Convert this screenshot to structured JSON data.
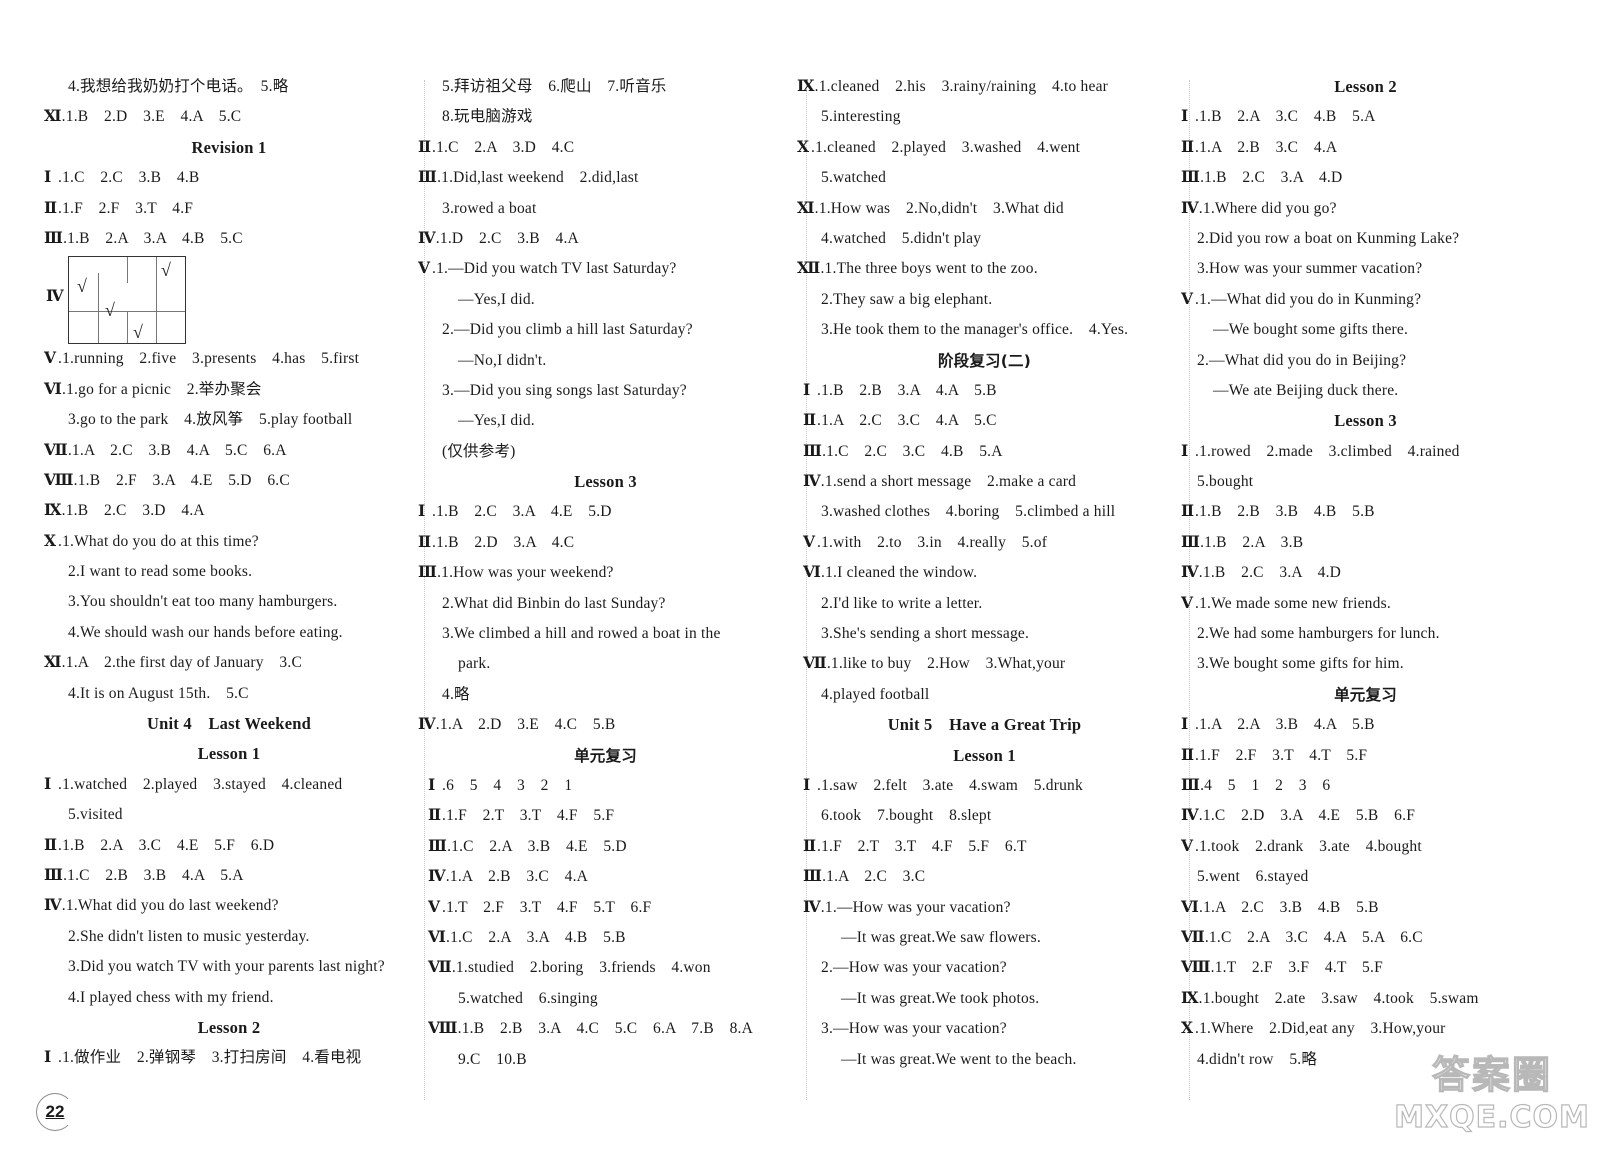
{
  "page_number": "22",
  "watermark": {
    "cn": "答案圈",
    "en": "MXQE.COM"
  },
  "col1": {
    "l01": "4.我想给我奶奶打个电话。　5.略",
    "l02": {
      "roman": "Ⅺ",
      "text": ".1.B　2.D　3.E　4.A　5.C"
    },
    "h_revision1": "Revision 1",
    "l03": {
      "roman": "Ⅰ",
      "text": ".1.C　2.C　3.B　4.B"
    },
    "l04": {
      "roman": "Ⅱ",
      "text": ".1.F　2.F　3.T　4.F"
    },
    "l05": {
      "roman": "Ⅲ",
      "text": ".1.B　2.A　3.A　4.B　5.C"
    },
    "grid": {
      "roman": "Ⅳ",
      "tick": "√",
      "checked_cells": [
        "row1-col1",
        "row1-col2",
        "row1-col4",
        "row2-col3"
      ]
    },
    "l06": {
      "roman": "Ⅴ",
      "text": ".1.running　2.five　3.presents　4.has　5.first"
    },
    "l07": {
      "roman": "Ⅵ",
      "text": ".1.go for a picnic　2.举办聚会"
    },
    "l08": "3.go to the park　4.放风筝　5.play football",
    "l09": {
      "roman": "Ⅶ",
      "text": ".1.A　2.C　3.B　4.A　5.C　6.A"
    },
    "l10": {
      "roman": "Ⅷ",
      "text": ".1.B　2.F　3.A　4.E　5.D　6.C"
    },
    "l11": {
      "roman": "Ⅸ",
      "text": ".1.B　2.C　3.D　4.A"
    },
    "l12": {
      "roman": "Ⅹ",
      "text": ".1.What do you do at this time?"
    },
    "l13": "2.I want to read some books.",
    "l14": "3.You shouldn't eat too many hamburgers.",
    "l15": "4.We should wash our hands before eating.",
    "l16": {
      "roman": "Ⅺ",
      "text": ".1.A　2.the first day of January　3.C"
    },
    "l17": "4.It is on August 15th.　5.C",
    "h_unit4": "Unit 4　Last Weekend",
    "h_lesson1": "Lesson 1",
    "l18": {
      "roman": "Ⅰ",
      "text": ".1.watched　2.played　3.stayed　4.cleaned"
    },
    "l19": "5.visited",
    "l20": {
      "roman": "Ⅱ",
      "text": ".1.B　2.A　3.C　4.E　5.F　6.D"
    },
    "l21": {
      "roman": "Ⅲ",
      "text": ".1.C　2.B　3.B　4.A　5.A"
    },
    "l22": {
      "roman": "Ⅳ",
      "text": ".1.What did you do last weekend?"
    },
    "l23": "2.She didn't listen to music yesterday.",
    "l24": "3.Did you watch TV with your parents last night?",
    "l25": "4.I played chess with my friend.",
    "h_lesson2": "Lesson 2",
    "l26": {
      "roman": "Ⅰ",
      "text": ".1.做作业　2.弹钢琴　3.打扫房间　4.看电视"
    }
  },
  "col2": {
    "l01": "5.拜访祖父母　6.爬山　7.听音乐",
    "l02": "8.玩电脑游戏",
    "l03": {
      "roman": "Ⅱ",
      "text": ".1.C　2.A　3.D　4.C"
    },
    "l04": {
      "roman": "Ⅲ",
      "text": ".1.Did,last weekend　2.did,last"
    },
    "l05": "3.rowed a boat",
    "l06": {
      "roman": "Ⅳ",
      "text": ".1.D　2.C　3.B　4.A"
    },
    "l07": {
      "roman": "Ⅴ",
      "text": ".1.—Did you watch TV last Saturday?"
    },
    "l08": "—Yes,I did.",
    "l09": "2.—Did you climb a hill last Saturday?",
    "l10": "—No,I didn't.",
    "l11": "3.—Did you sing songs last Saturday?",
    "l12": "—Yes,I did.",
    "l13": "(仅供参考)",
    "h_lesson3": "Lesson 3",
    "l14": {
      "roman": "Ⅰ",
      "text": ".1.B　2.C　3.A　4.E　5.D"
    },
    "l15": {
      "roman": "Ⅱ",
      "text": ".1.B　2.D　3.A　4.C"
    },
    "l16": {
      "roman": "Ⅲ",
      "text": ".1.How was your weekend?"
    },
    "l17": "2.What did Binbin do last Sunday?",
    "l18": "3.We climbed a hill and rowed a boat in the",
    "l19": "park.",
    "l20": "4.略",
    "l21": {
      "roman": "Ⅳ",
      "text": ".1.A　2.D　3.E　4.C　5.B"
    },
    "h_review": "单元复习",
    "l22": {
      "roman": "Ⅰ",
      "text": ".6　5　4　3　2　1"
    },
    "l23": {
      "roman": "Ⅱ",
      "text": ".1.F　2.T　3.T　4.F　5.F"
    },
    "l24": {
      "roman": "Ⅲ",
      "text": ".1.C　2.A　3.B　4.E　5.D"
    },
    "l25": {
      "roman": "Ⅳ",
      "text": ".1.A　2.B　3.C　4.A"
    },
    "l26": {
      "roman": "Ⅴ",
      "text": ".1.T　2.F　3.T　4.F　5.T　6.F"
    },
    "l27": {
      "roman": "Ⅵ",
      "text": ".1.C　2.A　3.A　4.B　5.B"
    },
    "l28": {
      "roman": "Ⅶ",
      "text": ".1.studied　2.boring　3.friends　4.won"
    },
    "l29": "5.watched　6.singing",
    "l30": {
      "roman": "Ⅷ",
      "text": ".1.B　2.B　3.A　4.C　5.C　6.A　7.B　8.A"
    },
    "l31": "9.C　10.B"
  },
  "col3": {
    "l01": {
      "roman": "Ⅸ",
      "text": ".1.cleaned　2.his　3.rainy/raining　4.to hear"
    },
    "l02": "5.interesting",
    "l03": {
      "roman": "Ⅹ",
      "text": ".1.cleaned　2.played　3.washed　4.went"
    },
    "l04": "5.watched",
    "l05": {
      "roman": "Ⅺ",
      "text": ".1.How was　2.No,didn't　3.What did"
    },
    "l06": "4.watched　5.didn't play",
    "l07": {
      "roman": "Ⅻ",
      "text": ".1.The three boys went to the zoo."
    },
    "l08": "2.They saw a big elephant.",
    "l09": "3.He took them to the manager's office.　4.Yes.",
    "h_stage2": "阶段复习(二)",
    "l10": {
      "roman": "Ⅰ",
      "text": ".1.B　2.B　3.A　4.A　5.B"
    },
    "l11": {
      "roman": "Ⅱ",
      "text": ".1.A　2.C　3.C　4.A　5.C"
    },
    "l12": {
      "roman": "Ⅲ",
      "text": ".1.C　2.C　3.C　4.B　5.A"
    },
    "l13": {
      "roman": "Ⅳ",
      "text": ".1.send a short message　2.make a card"
    },
    "l14": "3.washed clothes　4.boring　5.climbed a hill",
    "l15": {
      "roman": "Ⅴ",
      "text": ".1.with　2.to　3.in　4.really　5.of"
    },
    "l16": {
      "roman": "Ⅵ",
      "text": ".1.I cleaned the window."
    },
    "l17": "2.I'd like to write a letter.",
    "l18": "3.She's sending a short message.",
    "l19": {
      "roman": "Ⅶ",
      "text": ".1.like to buy　2.How　3.What,your"
    },
    "l20": "4.played football",
    "h_unit5": "Unit 5　Have a Great Trip",
    "h_lesson1": "Lesson 1",
    "l21": {
      "roman": "Ⅰ",
      "text": ".1.saw　2.felt　3.ate　4.swam　5.drunk"
    },
    "l22": "6.took　7.bought　8.slept",
    "l23": {
      "roman": "Ⅱ",
      "text": ".1.F　2.T　3.T　4.F　5.F　6.T"
    },
    "l24": {
      "roman": "Ⅲ",
      "text": ".1.A　2.C　3.C"
    },
    "l25": {
      "roman": "Ⅳ",
      "text": ".1.—How was your vacation?"
    },
    "l26": "—It was great.We saw flowers.",
    "l27": "2.—How was your vacation?",
    "l28": "—It was great.We took photos.",
    "l29": "3.—How was your vacation?",
    "l30": "—It was great.We went to the beach."
  },
  "col4": {
    "h_lesson2": "Lesson 2",
    "l01": {
      "roman": "Ⅰ",
      "text": ".1.B　2.A　3.C　4.B　5.A"
    },
    "l02": {
      "roman": "Ⅱ",
      "text": ".1.A　2.B　3.C　4.A"
    },
    "l03": {
      "roman": "Ⅲ",
      "text": ".1.B　2.C　3.A　4.D"
    },
    "l04": {
      "roman": "Ⅳ",
      "text": ".1.Where did you go?"
    },
    "l05": "2.Did you row a boat on Kunming Lake?",
    "l06": "3.How was your summer vacation?",
    "l07": {
      "roman": "Ⅴ",
      "text": ".1.—What did you do in Kunming?"
    },
    "l08": "—We bought some gifts there.",
    "l09": "2.—What did you do in Beijing?",
    "l10": "—We ate Beijing duck there.",
    "h_lesson3": "Lesson 3",
    "l11": {
      "roman": "Ⅰ",
      "text": ".1.rowed　2.made　3.climbed　4.rained"
    },
    "l12": "5.bought",
    "l13": {
      "roman": "Ⅱ",
      "text": ".1.B　2.B　3.B　4.B　5.B"
    },
    "l14": {
      "roman": "Ⅲ",
      "text": ".1.B　2.A　3.B"
    },
    "l15": {
      "roman": "Ⅳ",
      "text": ".1.B　2.C　3.A　4.D"
    },
    "l16": {
      "roman": "Ⅴ",
      "text": ".1.We made some new friends."
    },
    "l17": "2.We had some hamburgers for lunch.",
    "l18": "3.We bought some gifts for him.",
    "h_review": "单元复习",
    "l19": {
      "roman": "Ⅰ",
      "text": ".1.A　2.A　3.B　4.A　5.B"
    },
    "l20": {
      "roman": "Ⅱ",
      "text": ".1.F　2.F　3.T　4.T　5.F"
    },
    "l21": {
      "roman": "Ⅲ",
      "text": ".4　5　1　2　3　6"
    },
    "l22": {
      "roman": "Ⅳ",
      "text": ".1.C　2.D　3.A　4.E　5.B　6.F"
    },
    "l23": {
      "roman": "Ⅴ",
      "text": ".1.took　2.drank　3.ate　4.bought"
    },
    "l24": "5.went　6.stayed",
    "l25": {
      "roman": "Ⅵ",
      "text": ".1.A　2.C　3.B　4.B　5.B"
    },
    "l26": {
      "roman": "Ⅶ",
      "text": ".1.C　2.A　3.C　4.A　5.A　6.C"
    },
    "l27": {
      "roman": "Ⅷ",
      "text": ".1.T　2.F　3.F　4.T　5.F"
    },
    "l28": {
      "roman": "Ⅸ",
      "text": ".1.bought　2.ate　3.saw　4.took　5.swam"
    },
    "l29": {
      "roman": "Ⅹ",
      "text": ".1.Where　2.Did,eat any　3.How,your"
    },
    "l30": "4.didn't row　5.略"
  }
}
